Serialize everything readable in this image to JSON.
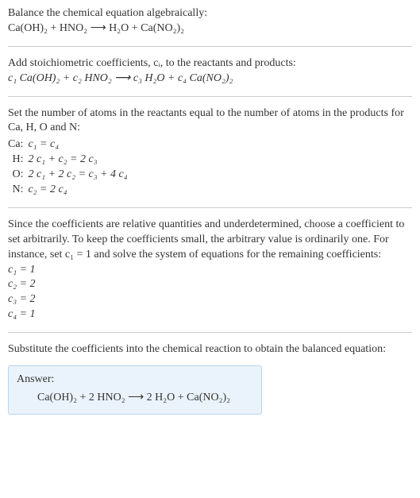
{
  "prompt": "Balance the chemical equation algebraically:",
  "reaction_plain": "Ca(OH)₂ + HNO₂ ⟶ H₂O + Ca(NO₂)₂",
  "step1_text": "Add stoichiometric coefficients, cᵢ, to the reactants and products:",
  "reaction_coeffs": "c₁ Ca(OH)₂ + c₂ HNO₂ ⟶ c₃ H₂O + c₄ Ca(NO₂)₂",
  "step2_text": "Set the number of atoms in the reactants equal to the number of atoms in the products for Ca, H, O and N:",
  "atom_eqs": [
    {
      "el": "Ca:",
      "eq": "c₁ = c₄"
    },
    {
      "el": "H:",
      "eq": "2 c₁ + c₂ = 2 c₃"
    },
    {
      "el": "O:",
      "eq": "2 c₁ + 2 c₂ = c₃ + 4 c₄"
    },
    {
      "el": "N:",
      "eq": "c₂ = 2 c₄"
    }
  ],
  "step3_text": "Since the coefficients are relative quantities and underdetermined, choose a coefficient to set arbitrarily. To keep the coefficients small, the arbitrary value is ordinarily one. For instance, set c₁ = 1 and solve the system of equations for the remaining coefficients:",
  "solutions": [
    "c₁ = 1",
    "c₂ = 2",
    "c₃ = 2",
    "c₄ = 1"
  ],
  "step4_text": "Substitute the coefficients into the chemical reaction to obtain the balanced equation:",
  "answer_label": "Answer:",
  "answer_eq": "Ca(OH)₂ + 2 HNO₂ ⟶ 2 H₂O + Ca(NO₂)₂",
  "chart_data": {
    "type": "table",
    "title": "Stoichiometric balance of Ca(OH)2 + HNO2 -> H2O + Ca(NO2)2",
    "elements": [
      "Ca",
      "H",
      "O",
      "N"
    ],
    "equations": [
      "c1 = c4",
      "2 c1 + c2 = 2 c3",
      "2 c1 + 2 c2 = c3 + 4 c4",
      "c2 = 2 c4"
    ],
    "solution": {
      "c1": 1,
      "c2": 2,
      "c3": 2,
      "c4": 1
    },
    "balanced_equation": "Ca(OH)2 + 2 HNO2 -> 2 H2O + Ca(NO2)2"
  }
}
